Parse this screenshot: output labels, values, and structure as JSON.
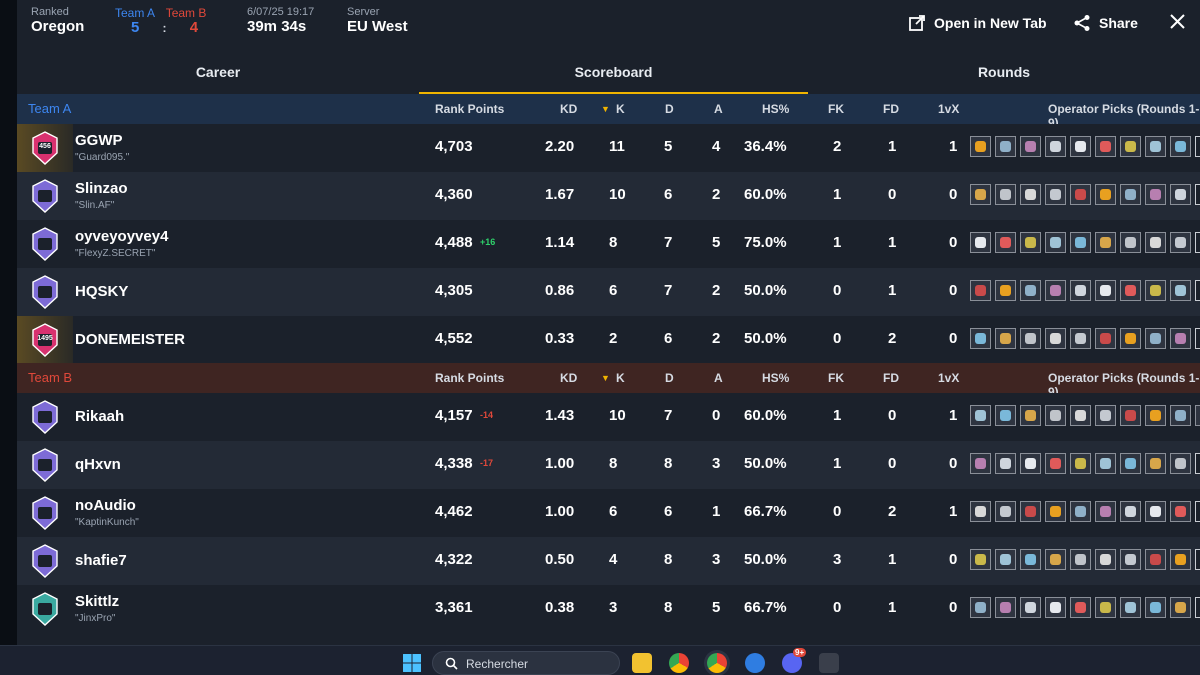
{
  "header": {
    "mode_label": "Ranked",
    "map": "Oregon",
    "team_a_label": "Team A",
    "team_b_label": "Team B",
    "score_a": "5",
    "score_sep": ":",
    "score_b": "4",
    "date": "6/07/25 19:17",
    "duration": "39m 34s",
    "server_label": "Server",
    "server": "EU West",
    "open_tab": "Open in New Tab",
    "share": "Share"
  },
  "tabs": [
    {
      "label": "Career"
    },
    {
      "label": "Scoreboard"
    },
    {
      "label": "Rounds"
    }
  ],
  "columns": {
    "rank_points": "Rank Points",
    "kd": "KD",
    "k": "K",
    "d": "D",
    "a": "A",
    "hs": "HS%",
    "fk": "FK",
    "fd": "FD",
    "vx": "1vX",
    "ops": "Operator Picks (Rounds 1-9)"
  },
  "team_a": {
    "name": "Team A",
    "players": [
      {
        "name": "GGWP",
        "tag": "\"Guard095.\"",
        "rank_badge": "456",
        "rp": "4,703",
        "delta": "",
        "kd": "2.20",
        "k": "11",
        "d": "5",
        "a": "4",
        "hs": "36.4%",
        "fk": "2",
        "fd": "1",
        "vx": "1"
      },
      {
        "name": "Slinzao",
        "tag": "\"Slin.AF\"",
        "rank_badge": "",
        "rp": "4,360",
        "delta": "",
        "kd": "1.67",
        "k": "10",
        "d": "6",
        "a": "2",
        "hs": "60.0%",
        "fk": "1",
        "fd": "0",
        "vx": "0"
      },
      {
        "name": "oyveyoyvey4",
        "tag": "\"FlexyZ.SECRET\"",
        "rank_badge": "",
        "rp": "4,488",
        "delta": "+16",
        "kd": "1.14",
        "k": "8",
        "d": "7",
        "a": "5",
        "hs": "75.0%",
        "fk": "1",
        "fd": "1",
        "vx": "0"
      },
      {
        "name": "HQSKY",
        "tag": "",
        "rank_badge": "",
        "rp": "4,305",
        "delta": "",
        "kd": "0.86",
        "k": "6",
        "d": "7",
        "a": "2",
        "hs": "50.0%",
        "fk": "0",
        "fd": "1",
        "vx": "0"
      },
      {
        "name": "DONEMEISTER",
        "tag": "",
        "rank_badge": "1495",
        "rp": "4,552",
        "delta": "",
        "kd": "0.33",
        "k": "2",
        "d": "6",
        "a": "2",
        "hs": "50.0%",
        "fk": "0",
        "fd": "2",
        "vx": "0"
      }
    ]
  },
  "team_b": {
    "name": "Team B",
    "players": [
      {
        "name": "Rikaah",
        "tag": "",
        "rank_badge": "",
        "rp": "4,157",
        "delta": "-14",
        "kd": "1.43",
        "k": "10",
        "d": "7",
        "a": "0",
        "hs": "60.0%",
        "fk": "1",
        "fd": "0",
        "vx": "1"
      },
      {
        "name": "qHxvn",
        "tag": "",
        "rank_badge": "",
        "rp": "4,338",
        "delta": "-17",
        "kd": "1.00",
        "k": "8",
        "d": "8",
        "a": "3",
        "hs": "50.0%",
        "fk": "1",
        "fd": "0",
        "vx": "0"
      },
      {
        "name": "noAudio",
        "tag": "\"KaptinKunch\"",
        "rank_badge": "",
        "rp": "4,462",
        "delta": "",
        "kd": "1.00",
        "k": "6",
        "d": "6",
        "a": "1",
        "hs": "66.7%",
        "fk": "0",
        "fd": "2",
        "vx": "1"
      },
      {
        "name": "shafie7",
        "tag": "",
        "rank_badge": "",
        "rp": "4,322",
        "delta": "",
        "kd": "0.50",
        "k": "4",
        "d": "8",
        "a": "3",
        "hs": "50.0%",
        "fk": "3",
        "fd": "1",
        "vx": "0"
      },
      {
        "name": "Skittlz",
        "tag": "\"JinxPro\"",
        "rank_badge": "",
        "rp": "3,361",
        "delta": "",
        "kd": "0.38",
        "k": "3",
        "d": "8",
        "a": "5",
        "hs": "66.7%",
        "fk": "0",
        "fd": "1",
        "vx": "0"
      }
    ]
  },
  "unknown_operator": "?",
  "taskbar": {
    "search_label": "Rechercher",
    "discord_badge": "9+"
  },
  "colors": {
    "team_a": "#3d86f0",
    "team_b": "#e0483a",
    "tab_accent": "#f0b400"
  }
}
